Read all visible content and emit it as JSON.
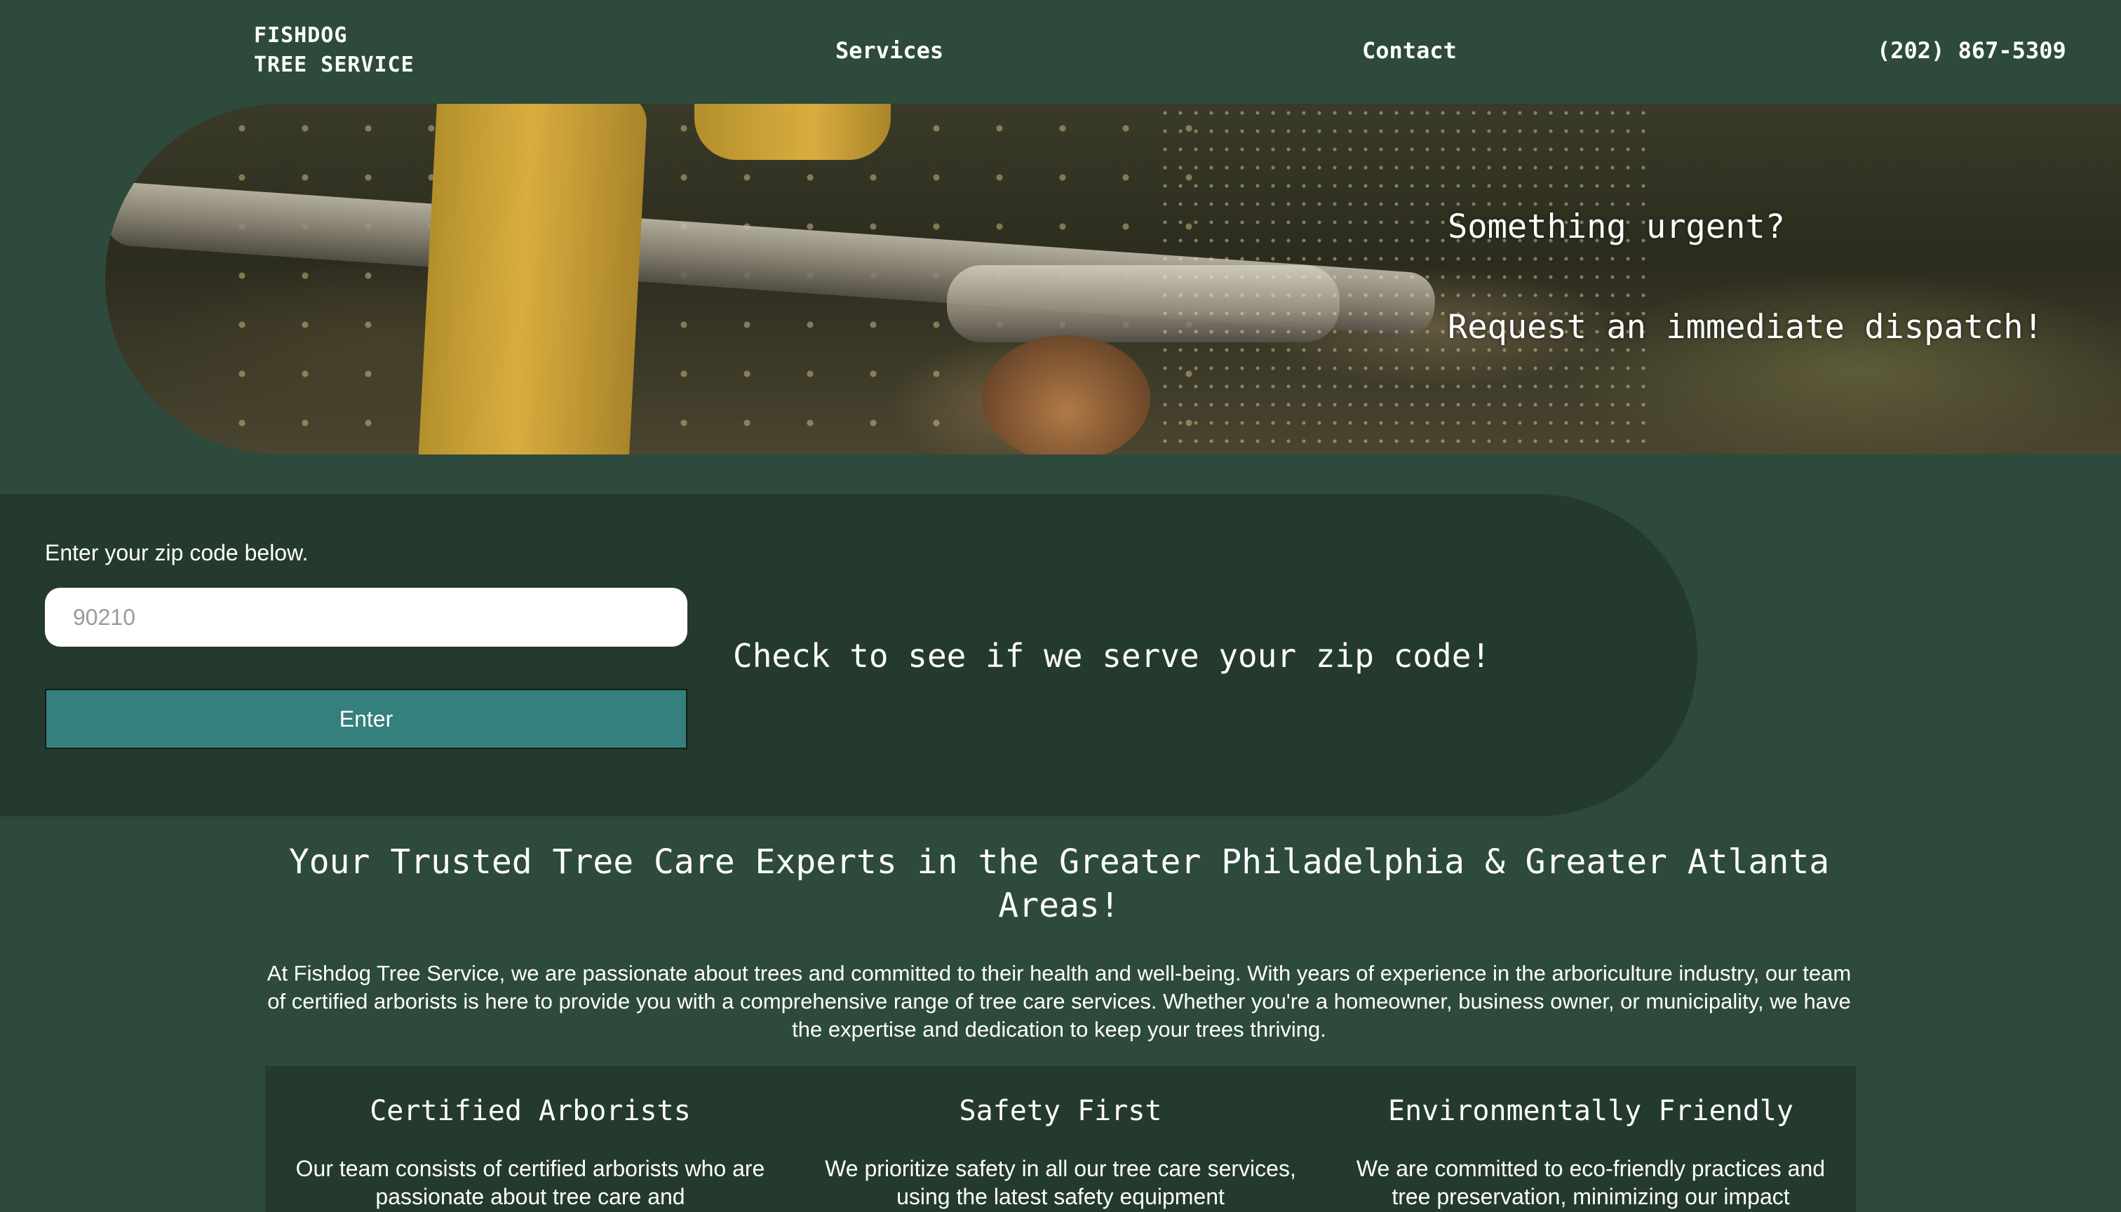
{
  "nav": {
    "logo_line1": "FISHDOG",
    "logo_line2": "TREE SERVICE",
    "links": [
      "Services",
      "Contact"
    ],
    "phone": "(202) 867-5309"
  },
  "hero": {
    "line1": "Something urgent?",
    "line2": "Request an immediate dispatch!"
  },
  "zip": {
    "label": "Enter your zip code below.",
    "placeholder": "90210",
    "button_label": "Enter",
    "heading": "Check to see if we serve your zip code!"
  },
  "about": {
    "title": "Your Trusted Tree Care Experts in the Greater Philadelphia & Greater Atlanta Areas!",
    "text": "At Fishdog Tree Service, we are passionate about trees and committed to their health and well-being. With years of experience in the arboriculture industry, our team of certified arborists is here to provide you with a comprehensive range of tree care services. Whether you're a homeowner, business owner, or municipality, we have the expertise and dedication to keep your trees thriving."
  },
  "features": [
    {
      "title": "Certified Arborists",
      "text": "Our team consists of certified arborists who are passionate about tree care and"
    },
    {
      "title": "Safety First",
      "text": "We prioritize safety in all our tree care services, using the latest safety equipment"
    },
    {
      "title": "Environmentally Friendly",
      "text": "We are committed to eco-friendly practices and tree preservation, minimizing our impact"
    }
  ],
  "colors": {
    "page_bg": "#2d4a3c",
    "panel_bg": "#243a2e",
    "button_bg": "#357f7c"
  }
}
